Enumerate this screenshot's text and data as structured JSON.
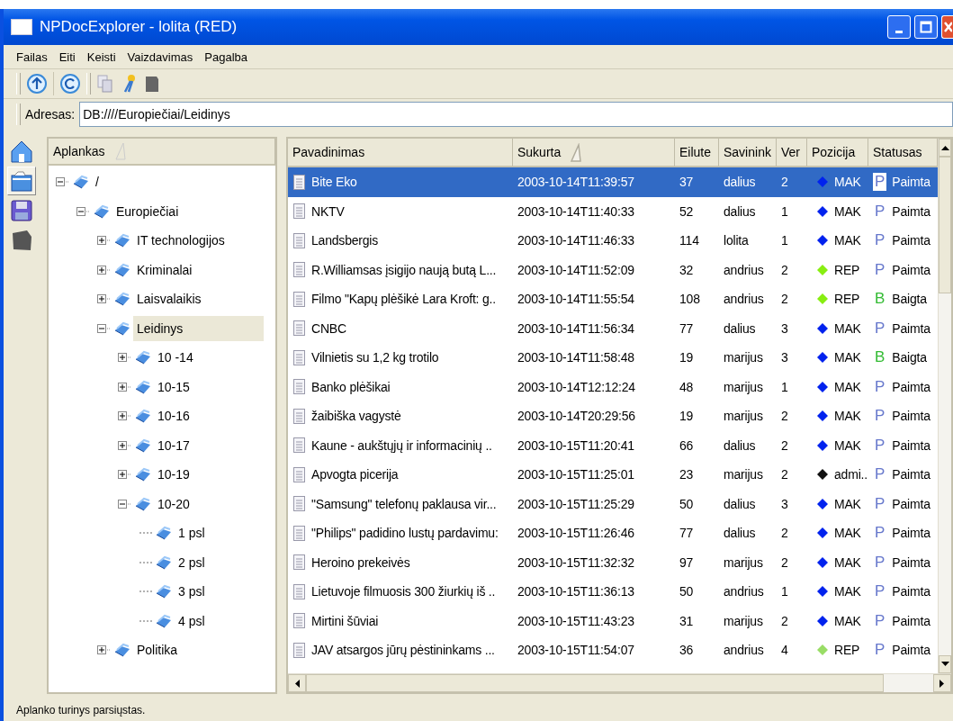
{
  "window": {
    "title": "NPDocExplorer - lolita (RED)"
  },
  "menu": [
    "Failas",
    "Eiti",
    "Keisti",
    "Vaizdavimas",
    "Pagalba"
  ],
  "address": {
    "label": "Adresas:",
    "value": "DB:////Europiečiai/Leidinys"
  },
  "side_buttons": [
    {
      "kind": "home",
      "selected": false
    },
    {
      "kind": "folder",
      "selected": true
    },
    {
      "kind": "disk",
      "selected": false
    },
    {
      "kind": "stamp",
      "selected": false
    }
  ],
  "tree": {
    "header": "Aplankas",
    "items": [
      {
        "label": "/",
        "expanded": true,
        "selected": false,
        "children": [
          {
            "label": "Europiečiai",
            "expanded": true,
            "selected": false,
            "children": [
              {
                "label": "IT technologijos",
                "expanded": false,
                "selected": false
              },
              {
                "label": "Kriminalai",
                "expanded": false,
                "selected": false
              },
              {
                "label": "Laisvalaikis",
                "expanded": false,
                "selected": false
              },
              {
                "label": "Leidinys",
                "expanded": true,
                "selected": true,
                "children": [
                  {
                    "label": "10 -14",
                    "expanded": false,
                    "selected": false
                  },
                  {
                    "label": "10-15",
                    "expanded": false,
                    "selected": false
                  },
                  {
                    "label": "10-16",
                    "expanded": false,
                    "selected": false
                  },
                  {
                    "label": "10-17",
                    "expanded": false,
                    "selected": false
                  },
                  {
                    "label": "10-19",
                    "expanded": false,
                    "selected": false
                  },
                  {
                    "label": "10-20",
                    "expanded": true,
                    "selected": false,
                    "children": [
                      {
                        "label": "1 psl",
                        "selected": false
                      },
                      {
                        "label": "2 psl",
                        "selected": false
                      },
                      {
                        "label": "3 psl",
                        "selected": false
                      },
                      {
                        "label": "4 psl",
                        "selected": false
                      }
                    ]
                  }
                ]
              },
              {
                "label": "Politika",
                "expanded": false,
                "selected": false
              }
            ]
          }
        ]
      }
    ]
  },
  "table": {
    "columns": [
      {
        "label": "Pavadinimas",
        "sorted": false
      },
      {
        "label": "Sukurta",
        "sorted": true
      },
      {
        "label": "Eilute",
        "sorted": false
      },
      {
        "label": "Savinink",
        "sorted": false
      },
      {
        "label": "Ver",
        "sorted": false
      },
      {
        "label": "Pozicija",
        "sorted": false
      },
      {
        "label": "Statusas",
        "sorted": false
      }
    ],
    "rows": [
      {
        "selected": true,
        "name": "Bite Eko",
        "created": "2003-10-14T11:39:57",
        "lines": "37",
        "owner": "dalius",
        "version": "2",
        "position": {
          "text": "MAK",
          "color": "#0022ee"
        },
        "status": {
          "letter": "P",
          "text": "Paimta",
          "color": "#6677cc"
        }
      },
      {
        "selected": false,
        "name": "NKTV",
        "created": "2003-10-14T11:40:33",
        "lines": "52",
        "owner": "dalius",
        "version": "1",
        "position": {
          "text": "MAK",
          "color": "#0022ee"
        },
        "status": {
          "letter": "P",
          "text": "Paimta",
          "color": "#6677cc"
        }
      },
      {
        "selected": false,
        "name": "Landsbergis",
        "created": "2003-10-14T11:46:33",
        "lines": "114",
        "owner": "lolita",
        "version": "1",
        "position": {
          "text": "MAK",
          "color": "#0022ee"
        },
        "status": {
          "letter": "P",
          "text": "Paimta",
          "color": "#6677cc"
        }
      },
      {
        "selected": false,
        "name": "R.Williamsas įsigijo naują butą L...",
        "created": "2003-10-14T11:52:09",
        "lines": "32",
        "owner": "andrius",
        "version": "2",
        "position": {
          "text": "REP",
          "color": "#88ee11"
        },
        "status": {
          "letter": "P",
          "text": "Paimta",
          "color": "#6677cc"
        }
      },
      {
        "selected": false,
        "name": "Filmo \"Kapų plėšikė Lara Kroft: g..",
        "created": "2003-10-14T11:55:54",
        "lines": "108",
        "owner": "andrius",
        "version": "2",
        "position": {
          "text": "REP",
          "color": "#88ee11"
        },
        "status": {
          "letter": "B",
          "text": "Baigta",
          "color": "#33bb33"
        }
      },
      {
        "selected": false,
        "name": "CNBC",
        "created": "2003-10-14T11:56:34",
        "lines": "77",
        "owner": "dalius",
        "version": "3",
        "position": {
          "text": "MAK",
          "color": "#0022ee"
        },
        "status": {
          "letter": "P",
          "text": "Paimta",
          "color": "#6677cc"
        }
      },
      {
        "selected": false,
        "name": "Vilnietis su 1,2 kg trotilo",
        "created": "2003-10-14T11:58:48",
        "lines": "19",
        "owner": "marijus",
        "version": "3",
        "position": {
          "text": "MAK",
          "color": "#0022ee"
        },
        "status": {
          "letter": "B",
          "text": "Baigta",
          "color": "#33bb33"
        }
      },
      {
        "selected": false,
        "name": "Banko plėšikai",
        "created": "2003-10-14T12:12:24",
        "lines": "48",
        "owner": "marijus",
        "version": "1",
        "position": {
          "text": "MAK",
          "color": "#0022ee"
        },
        "status": {
          "letter": "P",
          "text": "Paimta",
          "color": "#6677cc"
        }
      },
      {
        "selected": false,
        "name": "žaibiška vagystė",
        "created": "2003-10-14T20:29:56",
        "lines": "19",
        "owner": "marijus",
        "version": "2",
        "position": {
          "text": "MAK",
          "color": "#0022ee"
        },
        "status": {
          "letter": "P",
          "text": "Paimta",
          "color": "#6677cc"
        }
      },
      {
        "selected": false,
        "name": "Kaune - aukštųjų ir informacinių ..",
        "created": "2003-10-15T11:20:41",
        "lines": "66",
        "owner": "dalius",
        "version": "2",
        "position": {
          "text": "MAK",
          "color": "#0022ee"
        },
        "status": {
          "letter": "P",
          "text": "Paimta",
          "color": "#6677cc"
        }
      },
      {
        "selected": false,
        "name": "Apvogta picerija",
        "created": "2003-10-15T11:25:01",
        "lines": "23",
        "owner": "marijus",
        "version": "2",
        "position": {
          "text": "admi..",
          "color": "#111111"
        },
        "status": {
          "letter": "P",
          "text": "Paimta",
          "color": "#6677cc"
        }
      },
      {
        "selected": false,
        "name": "\"Samsung\" telefonų paklausa vir...",
        "created": "2003-10-15T11:25:29",
        "lines": "50",
        "owner": "dalius",
        "version": "3",
        "position": {
          "text": "MAK",
          "color": "#0022ee"
        },
        "status": {
          "letter": "P",
          "text": "Paimta",
          "color": "#6677cc"
        }
      },
      {
        "selected": false,
        "name": "\"Philips\" padidino lustų pardavimu:",
        "created": "2003-10-15T11:26:46",
        "lines": "77",
        "owner": "dalius",
        "version": "2",
        "position": {
          "text": "MAK",
          "color": "#0022ee"
        },
        "status": {
          "letter": "P",
          "text": "Paimta",
          "color": "#6677cc"
        }
      },
      {
        "selected": false,
        "name": "Heroino prekeivės",
        "created": "2003-10-15T11:32:32",
        "lines": "97",
        "owner": "marijus",
        "version": "2",
        "position": {
          "text": "MAK",
          "color": "#0022ee"
        },
        "status": {
          "letter": "P",
          "text": "Paimta",
          "color": "#6677cc"
        }
      },
      {
        "selected": false,
        "name": "Lietuvoje filmuosis 300 žiurkių iš ..",
        "created": "2003-10-15T11:36:13",
        "lines": "50",
        "owner": "andrius",
        "version": "1",
        "position": {
          "text": "MAK",
          "color": "#0022ee"
        },
        "status": {
          "letter": "P",
          "text": "Paimta",
          "color": "#6677cc"
        }
      },
      {
        "selected": false,
        "name": "Mirtini šūviai",
        "created": "2003-10-15T11:43:23",
        "lines": "31",
        "owner": "marijus",
        "version": "2",
        "position": {
          "text": "MAK",
          "color": "#0022ee"
        },
        "status": {
          "letter": "P",
          "text": "Paimta",
          "color": "#6677cc"
        }
      },
      {
        "selected": false,
        "name": "JAV atsargos jūrų pėstininkams ...",
        "created": "2003-10-15T11:54:07",
        "lines": "36",
        "owner": "andrius",
        "version": "4",
        "position": {
          "text": "REP",
          "color": "#99dd66"
        },
        "status": {
          "letter": "P",
          "text": "Paimta",
          "color": "#6677cc"
        }
      }
    ]
  },
  "status_bar": "Aplanko turinys parsiųstas."
}
